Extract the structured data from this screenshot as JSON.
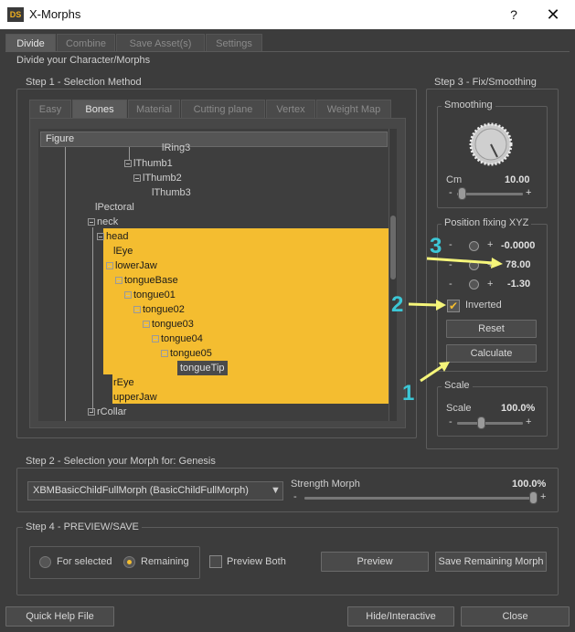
{
  "window": {
    "title": "X-Morphs",
    "app_badge": "DS",
    "help": "?",
    "close": "✕"
  },
  "main_tabs": [
    "Divide",
    "Combine",
    "Save Asset(s)",
    "Settings"
  ],
  "section_title": "Divide your Character/Morphs",
  "step1": {
    "title": "Step 1 - Selection Method",
    "tabs": [
      "Easy",
      "Bones",
      "Material",
      "Cutting plane",
      "Vertex",
      "Weight Map"
    ],
    "tree_header": "Figure",
    "nodes": [
      "lRing3",
      "lThumb1",
      "lThumb2",
      "lThumb3",
      "lPectoral",
      "neck",
      "head",
      "lEye",
      "lowerJaw",
      "tongueBase",
      "tongue01",
      "tongue02",
      "tongue03",
      "tongue04",
      "tongue05",
      "tongueTip",
      "rEye",
      "upperJaw",
      "rCollar"
    ]
  },
  "step3": {
    "title": "Step 3 - Fix/Smoothing",
    "smoothing": {
      "title": "Smoothing",
      "label": "Cm",
      "value": "10.00",
      "minus": "-",
      "plus": "+"
    },
    "position": {
      "title": "Position fixing XYZ",
      "x": "-0.0000",
      "y": "78.00",
      "z": "-1.30",
      "minus": "-",
      "plus": "+"
    },
    "inverted_label": "Inverted",
    "inverted_checked": true,
    "reset_label": "Reset",
    "calculate_label": "Calculate",
    "scale": {
      "title": "Scale",
      "label": "Scale",
      "value": "100.0%",
      "minus": "-",
      "plus": "+"
    }
  },
  "step2": {
    "title": "Step 2 - Selection your Morph for: Genesis",
    "morph_select": "XBMBasicChildFullMorph (BasicChildFullMorph)",
    "strength_label": "Strength Morph",
    "strength_value": "100.0%",
    "minus": "-",
    "plus": "+"
  },
  "step4": {
    "title": "Step 4 - PREVIEW/SAVE",
    "radio_selected_label": "For selected",
    "radio_remaining_label": "Remaining",
    "selected_radio": "Remaining",
    "preview_both_label": "Preview Both",
    "preview_label": "Preview",
    "save_label": "Save Remaining Morph"
  },
  "footer": {
    "quick_help": "Quick Help File",
    "hide_interactive": "Hide/Interactive",
    "close": "Close"
  },
  "annotations": [
    "1",
    "2",
    "3"
  ],
  "colors": {
    "selection": "#f4bd30",
    "annotation_arrow": "#f5f57a",
    "annotation_number": "#3cc7d6"
  }
}
